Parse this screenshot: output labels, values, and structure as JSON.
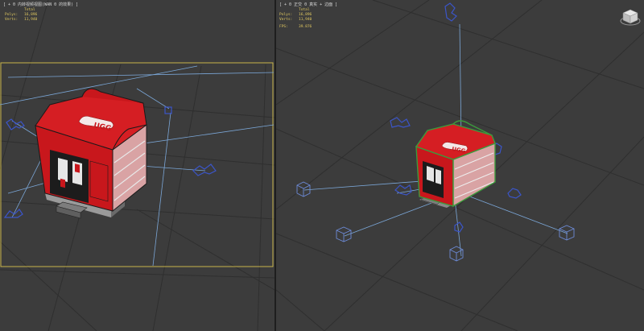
{
  "left_viewport": {
    "label": "[ + 0 内转视频视图(WAN 0 的效果) ]",
    "stats": {
      "total_label": "Total",
      "rows": [
        {
          "key": "Polys:",
          "value": "16,896"
        },
        {
          "key": "Verts:",
          "value": "11,940"
        }
      ]
    },
    "active": true
  },
  "right_viewport": {
    "label": "[ + 0 正交 0 真实 + 边面 ]",
    "stats": {
      "total_label": "Total",
      "rows": [
        {
          "key": "Polys:",
          "value": "16,896"
        },
        {
          "key": "Verts:",
          "value": "11,940"
        },
        {
          "key": "FPS:",
          "value": "39.876"
        }
      ]
    }
  },
  "sign_text": "UGG",
  "colors": {
    "viewport_bg": "#3c3c3c",
    "grid": "#2e2e2e",
    "active_border": "#c9b44a",
    "light_lines": "#7ba7d8",
    "helper_blue": "#3b55c8",
    "kiosk_red": "#c8171c",
    "selection_green": "#3c9a3c"
  },
  "icons": {
    "viewcube": "viewcube-icon",
    "light": "light-icon"
  }
}
